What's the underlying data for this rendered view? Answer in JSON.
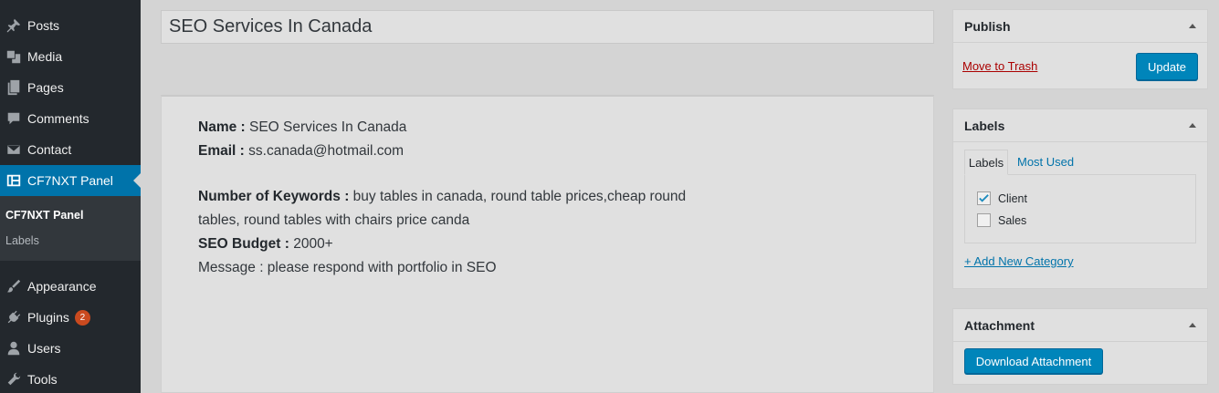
{
  "sidebar": {
    "items": [
      {
        "label": "Posts",
        "icon": "pin-icon"
      },
      {
        "label": "Media",
        "icon": "media-icon"
      },
      {
        "label": "Pages",
        "icon": "pages-icon"
      },
      {
        "label": "Comments",
        "icon": "comment-icon"
      },
      {
        "label": "Contact",
        "icon": "mail-icon"
      },
      {
        "label": "CF7NXT Panel",
        "icon": "panel-icon"
      },
      {
        "label": "Appearance",
        "icon": "brush-icon"
      },
      {
        "label": "Plugins",
        "icon": "plug-icon",
        "badge": "2"
      },
      {
        "label": "Users",
        "icon": "user-icon"
      },
      {
        "label": "Tools",
        "icon": "wrench-icon"
      }
    ],
    "submenu": [
      "CF7NXT Panel",
      "Labels"
    ]
  },
  "post": {
    "title": "SEO Services In Canada"
  },
  "message": {
    "name_label": "Name :",
    "name_value": "SEO Services In Canada",
    "email_label": "Email :",
    "email_value": "ss.canada@hotmail.com",
    "keywords_label": "Number of Keywords :",
    "keywords_value_line1": "buy tables in canada, round table prices,cheap round",
    "keywords_value_line2": "tables, round tables with chairs price canda",
    "budget_label": "SEO Budget :",
    "budget_value": "2000+",
    "message_line": "Message : please respond with portfolio in SEO"
  },
  "publish": {
    "title": "Publish",
    "trash": "Move to Trash",
    "update": "Update"
  },
  "labels_box": {
    "title": "Labels",
    "tab_all": "Labels",
    "tab_used": "Most Used",
    "categories": [
      {
        "name": "Client",
        "checked": true
      },
      {
        "name": "Sales",
        "checked": false
      }
    ],
    "add_new": "+ Add New Category"
  },
  "attachment": {
    "title": "Attachment",
    "download": "Download Attachment"
  },
  "colors": {
    "sidebar_bg": "#23282d",
    "accent": "#0073aa",
    "button": "#0085ba",
    "badge": "#ca4a1f"
  }
}
